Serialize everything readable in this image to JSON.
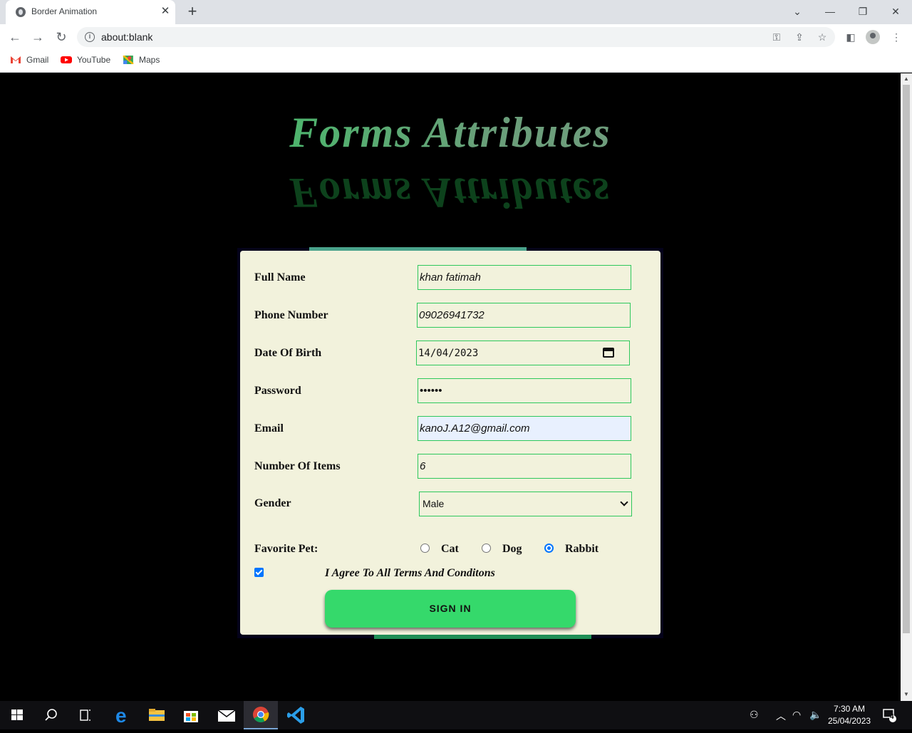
{
  "browser": {
    "tab_title": "Border Animation",
    "url": "about:blank",
    "bookmarks": [
      {
        "label": "Gmail",
        "icon": "gmail-icon"
      },
      {
        "label": "YouTube",
        "icon": "youtube-icon"
      },
      {
        "label": "Maps",
        "icon": "maps-icon"
      }
    ]
  },
  "page": {
    "heading": "Forms Attributes",
    "form": {
      "full_name_label": "Full Name",
      "full_name_value": "khan fatimah",
      "phone_label": "Phone Number",
      "phone_value": "09026941732",
      "dob_label": "Date Of Birth",
      "dob_value": "14/04/2023",
      "password_label": "Password",
      "password_value": "••••••",
      "email_label": "Email",
      "email_value": "kanoJ.A12@gmail.com",
      "items_label": "Number Of Items",
      "items_value": "6",
      "gender_label": "Gender",
      "gender_value": "Male",
      "pet_label": "Favorite Pet:",
      "pets": [
        "Cat",
        "Dog",
        "Rabbit"
      ],
      "selected_pet": "Rabbit",
      "agree_text": "I Agree To All Terms And Conditons",
      "agree_checked": true,
      "submit_label": "SIGN IN"
    }
  },
  "taskbar": {
    "time": "7:30 AM",
    "date": "25/04/2023",
    "notification_count": "4"
  },
  "colors": {
    "accent_green": "#35d96b",
    "card_bg": "#f2f2dc",
    "field_border": "#2ec85c",
    "radio_blue": "#0075ff"
  }
}
